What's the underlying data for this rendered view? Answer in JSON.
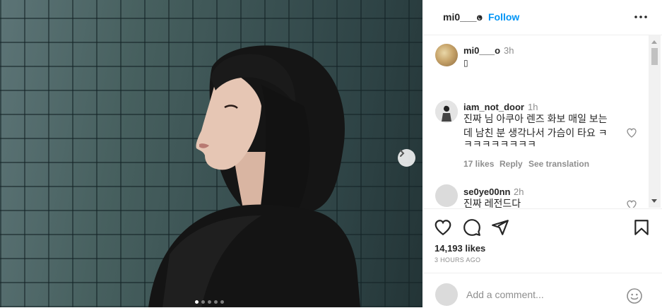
{
  "post": {
    "carousel": {
      "total_slides": 5,
      "active_slide": 1
    }
  },
  "header": {
    "username": "mi0___o",
    "separator": "•",
    "follow_label": "Follow",
    "more_icon": "more-horizontal-icon"
  },
  "comments": [
    {
      "username": "mi0___o",
      "time": "3h",
      "text": "▯"
    },
    {
      "username": "iam_not_door",
      "time": "1h",
      "lines": [
        "진짜 님 아쿠아 렌즈 화보 매일 보는",
        "데 남친 분 생각나서 가슴이 타요 ㅋ",
        "ㅋㅋㅋㅋㅋㅋㅋㅋ"
      ],
      "likes": "17 likes",
      "reply": "Reply",
      "translate": "See translation"
    },
    {
      "username": "se0ye00nn",
      "time": "2h",
      "text": "진짜 레전드다"
    }
  ],
  "actions": {
    "likes": "14,193 likes",
    "time_ago": "3 HOURS AGO"
  },
  "add_comment": {
    "placeholder": "Add a comment..."
  },
  "colors": {
    "accent": "#0095f6",
    "text": "#262626",
    "muted": "#8e8e8e",
    "border": "#efefef"
  }
}
